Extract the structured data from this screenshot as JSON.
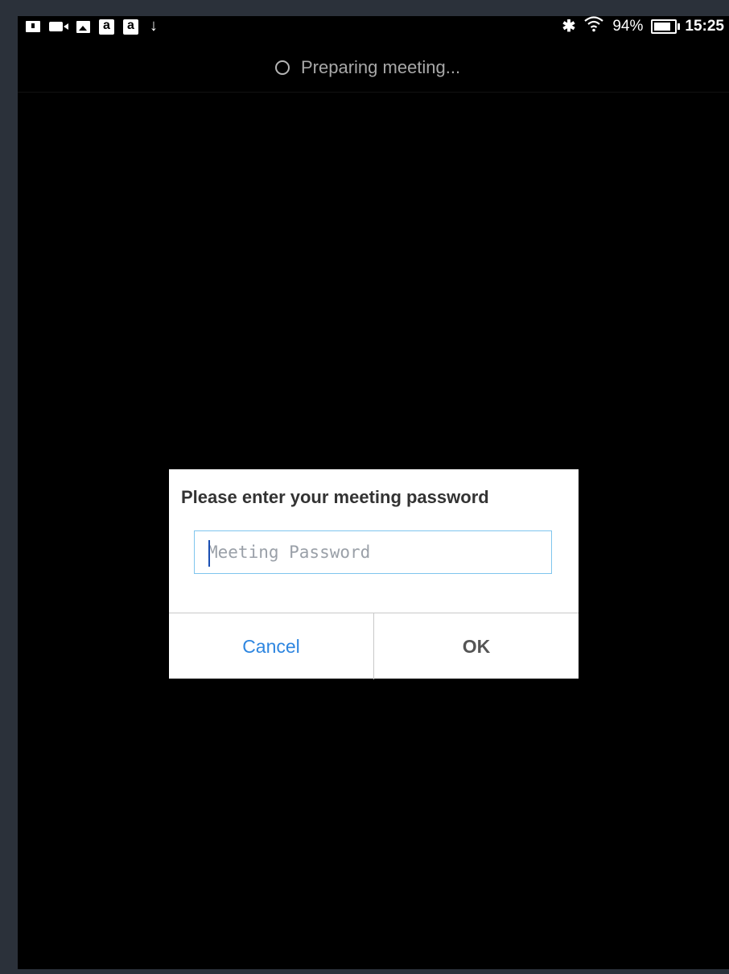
{
  "status_bar": {
    "left_icons": [
      "book-icon",
      "video-icon",
      "photo-icon",
      "amazon-icon",
      "amazon-icon",
      "download-icon"
    ],
    "amazon_glyph": "a",
    "download_glyph": "↓",
    "bluetooth_glyph": "✱",
    "battery_percent": "94%",
    "time": "15:25"
  },
  "header": {
    "status_text": "Preparing meeting..."
  },
  "dialog": {
    "title": "Please enter your meeting password",
    "password_placeholder": "Meeting Password",
    "password_value": "",
    "cancel_label": "Cancel",
    "ok_label": "OK"
  },
  "colors": {
    "accent": "#2e86e0",
    "input_border": "#7fc5ee",
    "background": "#000000"
  }
}
